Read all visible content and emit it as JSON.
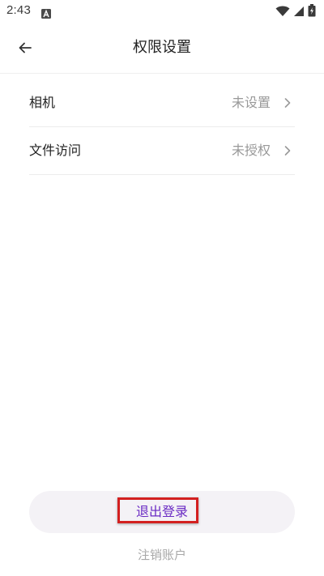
{
  "status_bar": {
    "time": "2:43",
    "app_icon": "a-badge-icon",
    "wifi_icon": "wifi-icon",
    "signal_icon": "signal-icon",
    "battery_icon": "battery-charging-icon"
  },
  "header": {
    "back_icon": "arrow-left-icon",
    "title": "权限设置"
  },
  "settings": {
    "items": [
      {
        "label": "相机",
        "value": "未设置",
        "chevron_icon": "chevron-right-icon"
      },
      {
        "label": "文件访问",
        "value": "未授权",
        "chevron_icon": "chevron-right-icon"
      }
    ]
  },
  "actions": {
    "logout_label": "退出登录",
    "delete_account_label": "注销账户"
  },
  "colors": {
    "accent": "#6a2bc4",
    "highlight_border": "#d32020",
    "muted_text": "#999999",
    "button_background": "#f4f2f6"
  }
}
